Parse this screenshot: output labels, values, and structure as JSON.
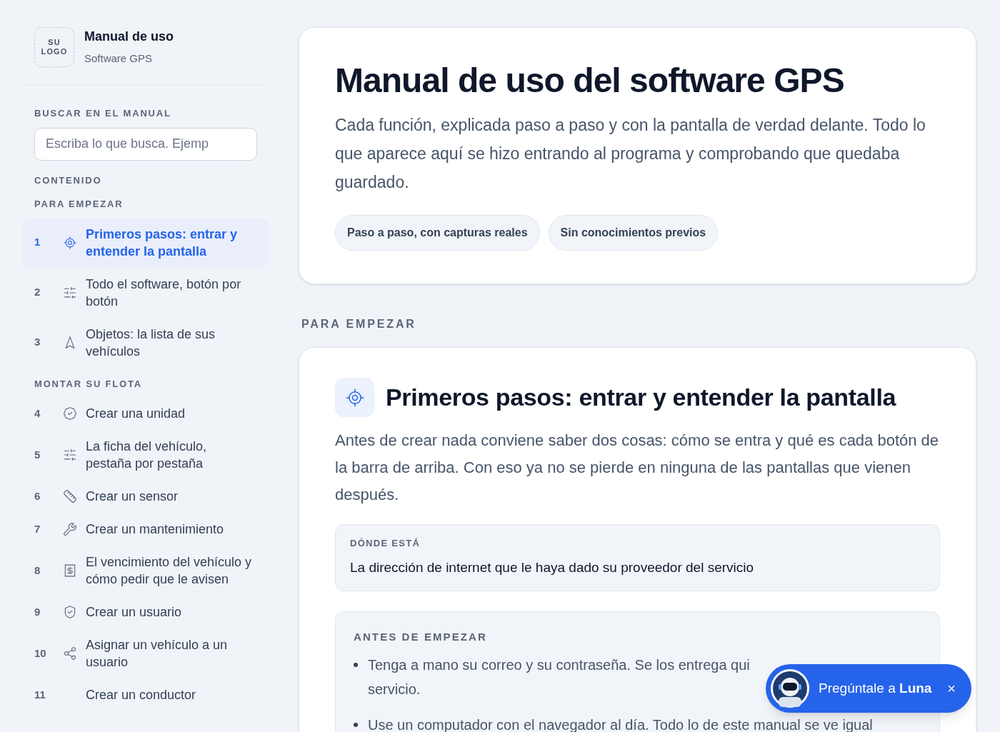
{
  "sidebar": {
    "logo": [
      "SU",
      "LOGO"
    ],
    "title": "Manual de uso",
    "subtitle": "Software GPS",
    "search": {
      "label": "BUSCAR EN EL MANUAL",
      "placeholder": "Escriba lo que busca. Ejemp"
    },
    "contents_label": "CONTENIDO",
    "groups": [
      {
        "label": "PARA EMPEZAR",
        "items": [
          {
            "number": "1",
            "label": "Primeros pasos: entrar y entender la pantalla",
            "selected": true
          },
          {
            "number": "2",
            "label": "Todo el software, botón por botón",
            "selected": false
          },
          {
            "number": "3",
            "label": "Objetos: la lista de sus vehículos",
            "selected": false
          }
        ]
      },
      {
        "label": "MONTAR SU FLOTA",
        "items": [
          {
            "number": "4",
            "label": "Crear una unidad",
            "selected": false
          },
          {
            "number": "5",
            "label": "La ficha del vehículo, pestaña por pestaña",
            "selected": false
          },
          {
            "number": "6",
            "label": "Crear un sensor",
            "selected": false
          },
          {
            "number": "7",
            "label": "Crear un mantenimiento",
            "selected": false
          },
          {
            "number": "8",
            "label": "El vencimiento del vehículo y cómo pedir que le avisen",
            "selected": false
          },
          {
            "number": "9",
            "label": "Crear un usuario",
            "selected": false
          },
          {
            "number": "10",
            "label": "Asignar un vehículo a un usuario",
            "selected": false
          },
          {
            "number": "11",
            "label": "Crear un conductor",
            "selected": false
          }
        ]
      }
    ]
  },
  "hero": {
    "title": "Manual de uso del software GPS",
    "text": "Cada función, explicada paso a paso y con la pantalla de verdad delante. Todo lo que aparece aquí se hizo entrando al programa y comprobando que quedaba guardado.",
    "tags": [
      "Paso a paso, con capturas reales",
      "Sin conocimientos previos"
    ]
  },
  "section_label": "PARA EMPEZAR",
  "section": {
    "title": "Primeros pasos: entrar y entender la pantalla",
    "text": "Antes de crear nada conviene saber dos cosas: cómo se entra y qué es cada botón de la barra de arriba. Con eso ya no se pierde en ninguna de las pantallas que vienen después.",
    "where": {
      "label": "DÓNDE ESTÁ",
      "text": "La dirección de internet que le haya dado su proveedor del servicio"
    },
    "before": {
      "label": "ANTES DE EMPEZAR",
      "bullets": [
        [
          "Tenga a mano su correo y su contraseña. Se los entrega qui",
          "servicio."
        ],
        [
          "Use un computador con el navegador al día. Todo lo de este manual se ve igual"
        ]
      ]
    }
  },
  "chat": {
    "text": "Pregúntale a **Luna**",
    "close": "×"
  }
}
